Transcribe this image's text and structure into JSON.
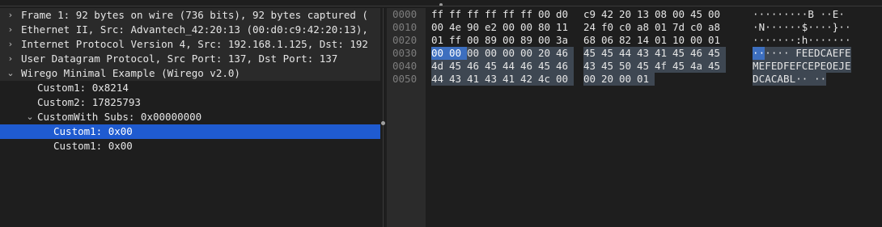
{
  "tree": [
    {
      "label": "Frame 1: 92 bytes on wire (736 bits), 92 bytes captured (",
      "level": 0,
      "chevron": "›"
    },
    {
      "label": "Ethernet II, Src: Advantech_42:20:13 (00:d0:c9:42:20:13),",
      "level": 0,
      "chevron": "›"
    },
    {
      "label": "Internet Protocol Version 4, Src: 192.168.1.125, Dst: 192",
      "level": 0,
      "chevron": "›"
    },
    {
      "label": "User Datagram Protocol, Src Port: 137, Dst Port: 137",
      "level": 0,
      "chevron": "›"
    },
    {
      "label": "Wirego Minimal Example (Wirego v2.0)",
      "level": 0,
      "chevron": "⌄"
    },
    {
      "label": "Custom1: 0x8214",
      "level": 1,
      "chevron": ""
    },
    {
      "label": "Custom2: 17825793",
      "level": 1,
      "chevron": ""
    },
    {
      "label": "CustomWith Subs: 0x00000000",
      "level": 1,
      "chevron": "⌄"
    },
    {
      "label": "Custom1: 0x00",
      "level": 2,
      "chevron": "",
      "selected": true
    },
    {
      "label": "Custom1: 0x00",
      "level": 2,
      "chevron": ""
    }
  ],
  "bytes": {
    "offsets": [
      "0000",
      "0010",
      "0020",
      "0030",
      "0040",
      "0050"
    ],
    "hex": [
      [
        "ff",
        "ff",
        "ff",
        "ff",
        "ff",
        "ff",
        "00",
        "d0",
        "c9",
        "42",
        "20",
        "13",
        "08",
        "00",
        "45",
        "00"
      ],
      [
        "00",
        "4e",
        "90",
        "e2",
        "00",
        "00",
        "80",
        "11",
        "24",
        "f0",
        "c0",
        "a8",
        "01",
        "7d",
        "c0",
        "a8"
      ],
      [
        "01",
        "ff",
        "00",
        "89",
        "00",
        "89",
        "00",
        "3a",
        "68",
        "06",
        "82",
        "14",
        "01",
        "10",
        "00",
        "01"
      ],
      [
        "00",
        "00",
        "00",
        "00",
        "00",
        "00",
        "20",
        "46",
        "45",
        "45",
        "44",
        "43",
        "41",
        "45",
        "46",
        "45"
      ],
      [
        "4d",
        "45",
        "46",
        "45",
        "44",
        "46",
        "45",
        "46",
        "43",
        "45",
        "50",
        "45",
        "4f",
        "45",
        "4a",
        "45"
      ],
      [
        "44",
        "43",
        "41",
        "43",
        "41",
        "42",
        "4c",
        "00",
        "00",
        "20",
        "00",
        "01"
      ]
    ],
    "ascii": [
      [
        "·",
        "·",
        "·",
        "·",
        "·",
        "·",
        "·",
        "·",
        "·",
        "B",
        " ",
        "·",
        "·",
        "E",
        "·",
        " "
      ],
      [
        "·",
        "N",
        "·",
        "·",
        "·",
        "·",
        "·",
        "·",
        "$",
        "·",
        "·",
        "·",
        "·",
        "}",
        "·",
        "·"
      ],
      [
        "·",
        "·",
        "·",
        "·",
        "·",
        "·",
        "·",
        ":",
        "h",
        "·",
        "·",
        "·",
        "·",
        "·",
        "·",
        "·"
      ],
      [
        "·",
        "·",
        "·",
        "·",
        "·",
        "·",
        " ",
        "F",
        "E",
        "E",
        "D",
        "C",
        "A",
        "E",
        "F",
        "E"
      ],
      [
        "M",
        "E",
        "F",
        "E",
        "D",
        "F",
        "E",
        "F",
        "C",
        "E",
        "P",
        "E",
        "O",
        "E",
        "J",
        "E"
      ],
      [
        "D",
        "C",
        "A",
        "C",
        "A",
        "B",
        "L",
        "·",
        "·",
        " ",
        "·",
        "·"
      ]
    ],
    "highlight": {
      "strong": [
        [
          3,
          0
        ],
        [
          3,
          1
        ]
      ],
      "dim_rows_from": [
        3,
        2
      ],
      "dim_rows_to": [
        5,
        11
      ]
    }
  }
}
